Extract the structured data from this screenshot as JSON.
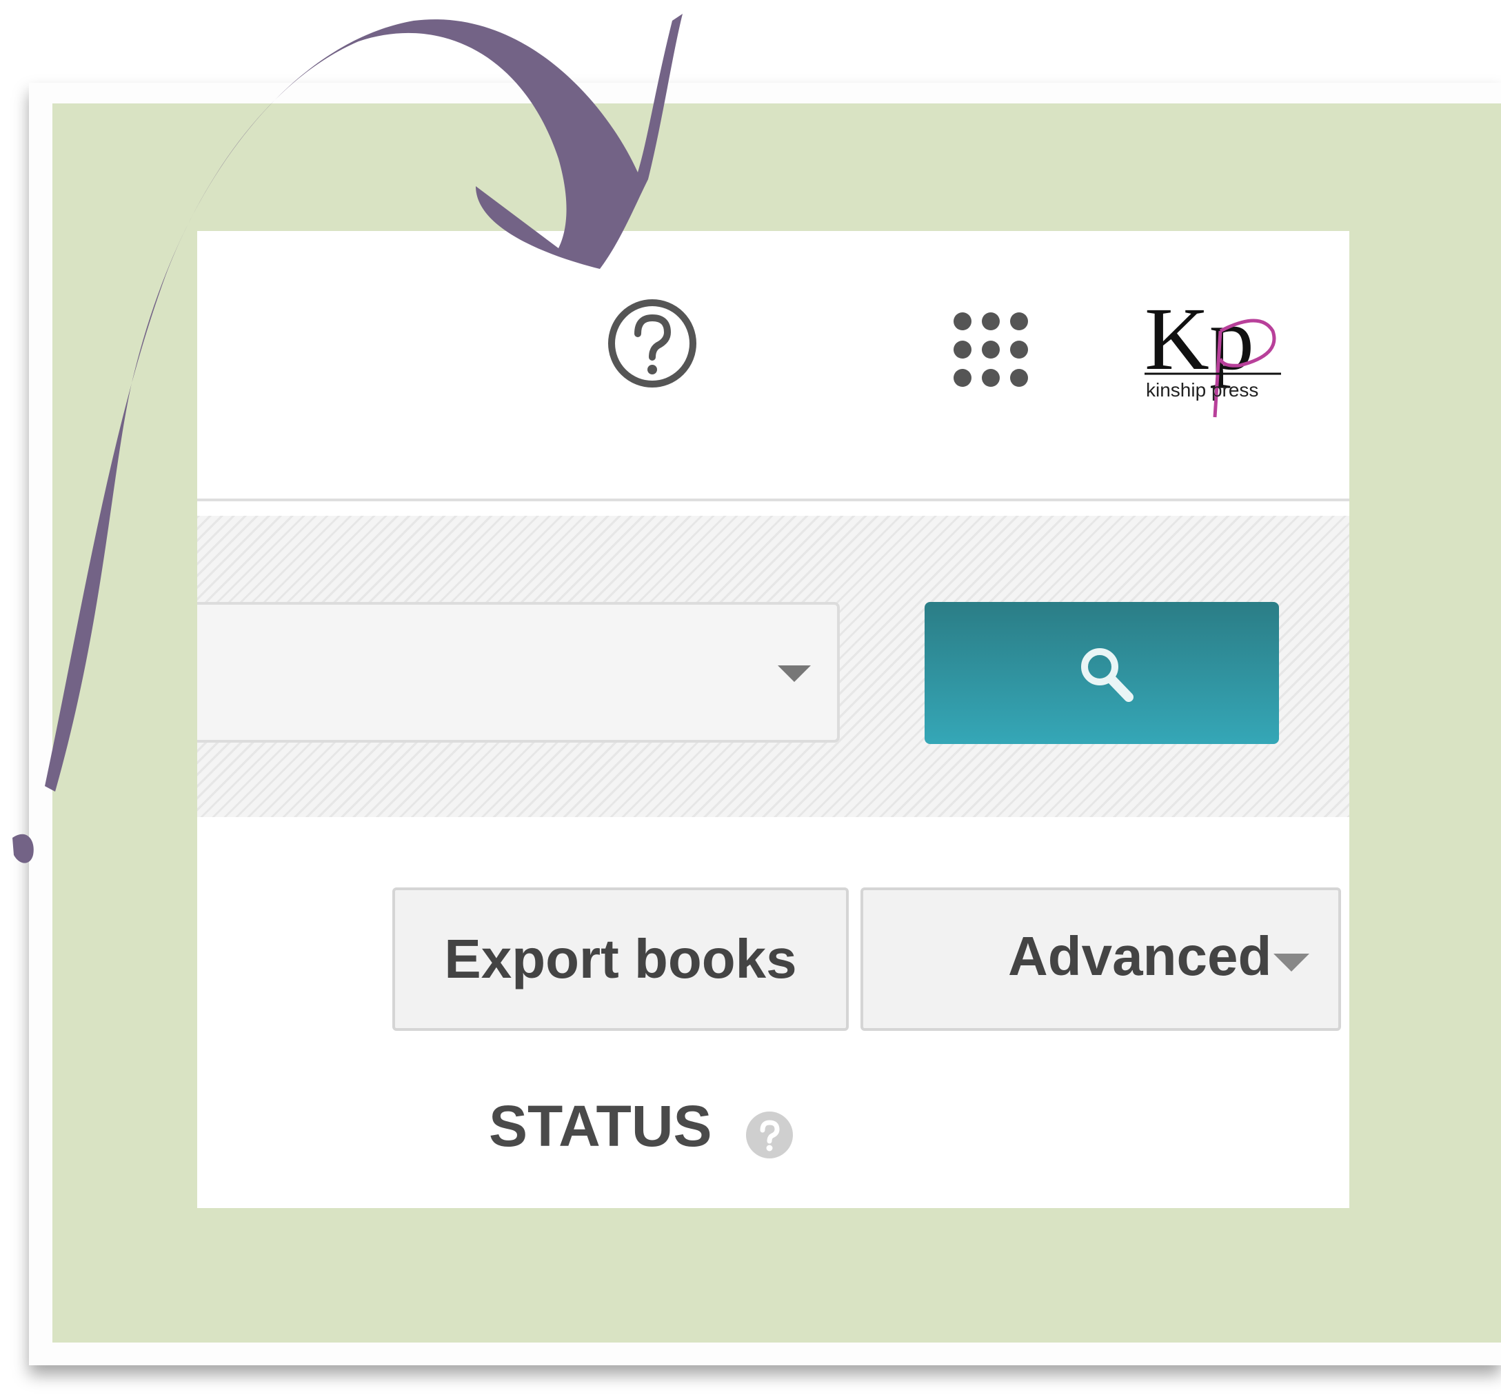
{
  "header": {
    "help_icon": "help-circle-icon",
    "apps_icon": "apps-grid-icon",
    "logo": {
      "letters": "Kp",
      "wordmark": "kinship press"
    }
  },
  "search": {
    "select_value": "",
    "button_icon": "search-icon"
  },
  "toolbar": {
    "export_label": "Export books",
    "advanced_label": "Advanced"
  },
  "table": {
    "truncated_column": ".",
    "status_header": "STATUS"
  },
  "colors": {
    "mat": "#d9e3c3",
    "arrow": "#736386",
    "search_button": "#2f8f9a",
    "logo_accent": "#b8409a"
  }
}
